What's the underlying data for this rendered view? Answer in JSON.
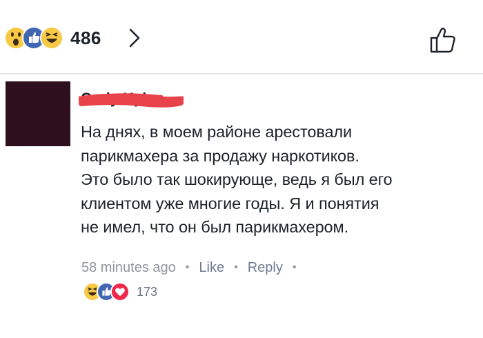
{
  "top_bar": {
    "reaction_count": "486",
    "reactions": [
      "wow-emoji",
      "like-emoji",
      "haha-emoji"
    ]
  },
  "comment": {
    "author_name": "Cody Kyle",
    "text_lines": [
      "На днях, в моем районе арестовали",
      "парикмахера за продажу наркотиков.",
      "Это было так шокирующе, ведь я был его",
      "клиентом уже многие годы. Я и понятия",
      "не имел, что он был парикмахером."
    ],
    "timestamp": "58 minutes ago",
    "like_label": "Like",
    "reply_label": "Reply",
    "reaction_count": "173",
    "reactions": [
      "haha-emoji",
      "like-emoji",
      "love-emoji"
    ]
  },
  "colors": {
    "like_blue": "#4267b2",
    "emoji_yellow": "#f7c945",
    "love_red": "#f0284a",
    "avatar": "#2d0f1d",
    "scribble_red": "#e8434a",
    "text": "#1d2129",
    "meta": "#90949c"
  }
}
